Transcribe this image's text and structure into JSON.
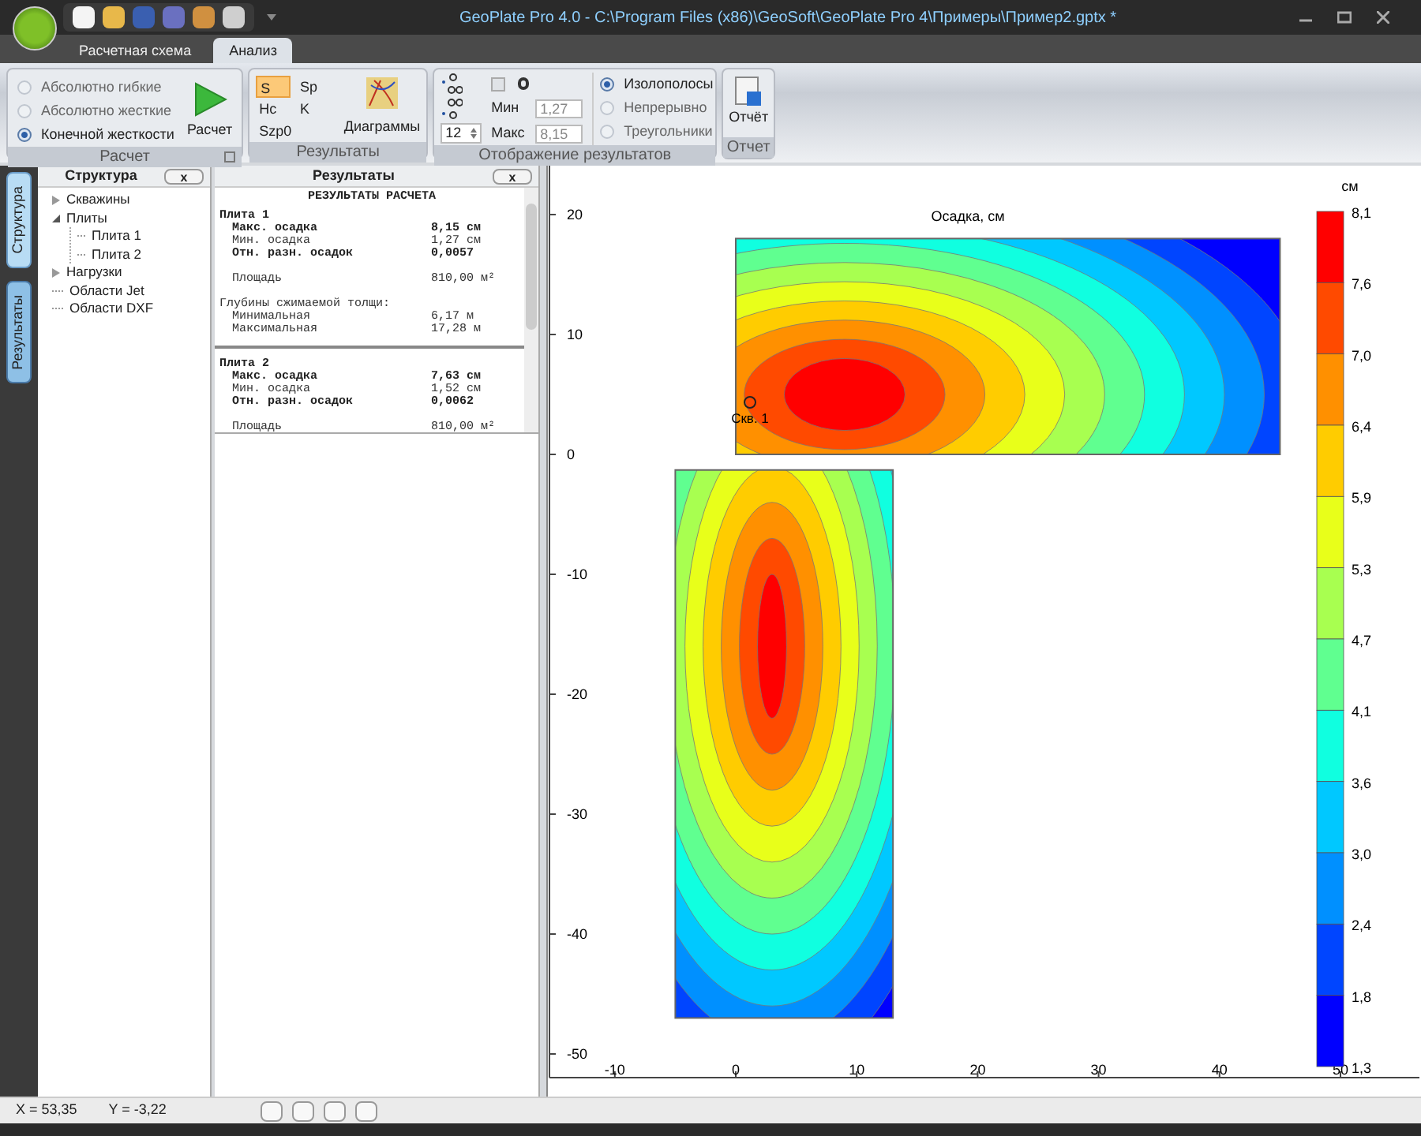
{
  "window": {
    "title": "GeoPlate Pro 4.0 - C:\\Program Files (x86)\\GeoSoft\\GeoPlate Pro 4\\Примеры\\Пример2.gptx *"
  },
  "ribbon_tabs": [
    {
      "label": "Расчетная схема",
      "selected": false
    },
    {
      "label": "Анализ",
      "selected": true
    }
  ],
  "ribbon": {
    "calc": {
      "label": "Расчет",
      "options": [
        {
          "label": "Абсолютно гибкие",
          "selected": false
        },
        {
          "label": "Абсолютно жесткие",
          "selected": false
        },
        {
          "label": "Конечной жесткости",
          "selected": true
        }
      ],
      "button": "Расчет"
    },
    "results": {
      "label": "Результаты",
      "toggles": [
        {
          "label": "S",
          "selected": true
        },
        {
          "label": "Sp",
          "selected": false
        },
        {
          "label": "Hc",
          "selected": false
        },
        {
          "label": "K",
          "selected": false
        },
        {
          "label": "Szp0",
          "selected": false
        }
      ],
      "button": "Диаграммы"
    },
    "display": {
      "label": "Отображение результатов",
      "digits": "12",
      "lock_checked": false,
      "min_label": "Мин",
      "min_value": "1,27",
      "max_label": "Макс",
      "max_value": "8,15",
      "modes": [
        {
          "label": "Изолополосы",
          "selected": true
        },
        {
          "label": "Непрерывно",
          "selected": false
        },
        {
          "label": "Треугольники",
          "selected": false
        }
      ]
    },
    "report": {
      "label": "Отчет",
      "button": "Отчёт"
    }
  },
  "side_tabs": [
    {
      "label": "Структура",
      "selected": true
    },
    {
      "label": "Результаты",
      "selected": false
    }
  ],
  "structure": {
    "title": "Структура",
    "close": "x",
    "tree": [
      {
        "label": "Скважины",
        "expanded": false
      },
      {
        "label": "Плиты",
        "expanded": true,
        "children": [
          {
            "label": "Плита 1"
          },
          {
            "label": "Плита 2"
          }
        ]
      },
      {
        "label": "Нагрузки",
        "expanded": false
      },
      {
        "label": "Области Jet"
      },
      {
        "label": "Области DXF"
      }
    ]
  },
  "results_panel": {
    "title": "Результаты",
    "close": "x",
    "heading": "РЕЗУЛЬТАТЫ РАСЧЕТА",
    "lines": [
      {
        "kind": "plate",
        "text": "Плита 1"
      },
      {
        "kind": "row",
        "label": "Макс. осадка",
        "value": "8,15 см",
        "bold": true
      },
      {
        "kind": "row",
        "label": "Мин. осадка",
        "value": "1,27 см",
        "bold": false
      },
      {
        "kind": "row",
        "label": "Отн. разн. осадок",
        "value": "0,0057",
        "bold": true
      },
      {
        "kind": "gap"
      },
      {
        "kind": "row",
        "label": "Площадь",
        "value": "810,00 м²",
        "bold": false
      },
      {
        "kind": "gap"
      },
      {
        "kind": "note",
        "text": "Глубины сжимаемой толщи:"
      },
      {
        "kind": "row",
        "label": "Минимальная",
        "value": "6,17 м",
        "bold": false
      },
      {
        "kind": "row",
        "label": "Максимальная",
        "value": "17,28 м",
        "bold": false
      },
      {
        "kind": "rule"
      },
      {
        "kind": "plate",
        "text": "Плита 2"
      },
      {
        "kind": "row",
        "label": "Макс. осадка",
        "value": "7,63 см",
        "bold": true
      },
      {
        "kind": "row",
        "label": "Мин. осадка",
        "value": "1,52 см",
        "bold": false
      },
      {
        "kind": "row",
        "label": "Отн. разн. осадок",
        "value": "0,0062",
        "bold": true
      },
      {
        "kind": "gap"
      },
      {
        "kind": "row",
        "label": "Площадь",
        "value": "810,00 м²",
        "bold": false
      }
    ]
  },
  "plot": {
    "title": "Осадка, см",
    "well_label": "Скв. 1",
    "x_ticks": [
      "-10",
      "0",
      "10",
      "20",
      "30",
      "40",
      "50"
    ],
    "y_ticks": [
      "20",
      "10",
      "0",
      "-10",
      "-20",
      "-30",
      "-40",
      "-50"
    ],
    "legend": {
      "unit": "см",
      "labels": [
        "8,1",
        "7,6",
        "7,0",
        "6,4",
        "5,9",
        "5,3",
        "4,7",
        "4,1",
        "3,6",
        "3,0",
        "2,4",
        "1,8",
        "1,3"
      ],
      "bands": [
        {
          "color": "#ff0000"
        },
        {
          "color": "#ff4a00"
        },
        {
          "color": "#ff9000"
        },
        {
          "color": "#ffcc00"
        },
        {
          "color": "#e8ff1a"
        },
        {
          "color": "#a8ff50"
        },
        {
          "color": "#60ff90"
        },
        {
          "color": "#10ffe0"
        },
        {
          "color": "#00c8ff"
        },
        {
          "color": "#0090ff"
        },
        {
          "color": "#0045ff"
        },
        {
          "color": "#0000ff"
        }
      ]
    }
  },
  "status_bar": {
    "x": "X = 53,35",
    "y": "Y = -3,22"
  }
}
